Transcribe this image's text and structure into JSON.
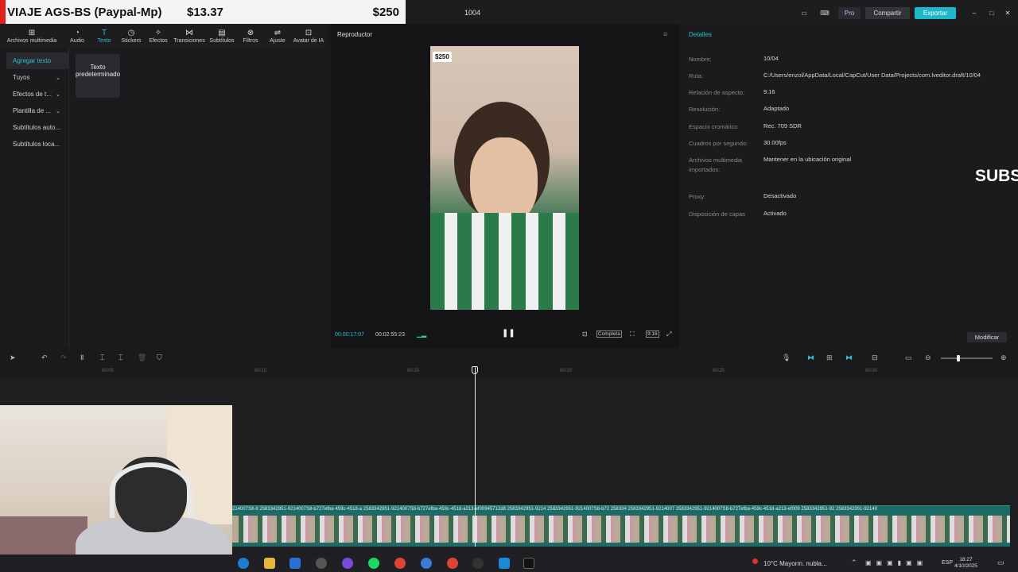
{
  "donation": {
    "name": "VIAJE AGS-BS (Paypal-Mp)",
    "amount_1": "$13.37",
    "amount_2": "$250"
  },
  "titlebar": {
    "project": "1004",
    "pro_label": "Pro",
    "share_label": "Compartir",
    "export_label": "Exportar"
  },
  "toolbar": [
    {
      "label": "Archivos multimedia",
      "icon": "media-icon"
    },
    {
      "label": "Audio",
      "icon": "audio-icon"
    },
    {
      "label": "Texto",
      "icon": "text-icon",
      "active": true
    },
    {
      "label": "Stickers",
      "icon": "sticker-icon"
    },
    {
      "label": "Efectos",
      "icon": "effects-icon"
    },
    {
      "label": "Transiciones",
      "icon": "transition-icon"
    },
    {
      "label": "Subtítulos",
      "icon": "subtitle-icon"
    },
    {
      "label": "Filtros",
      "icon": "filter-icon"
    },
    {
      "label": "Ajuste",
      "icon": "adjust-icon"
    },
    {
      "label": "Avatar de IA",
      "icon": "avatar-icon"
    }
  ],
  "sidebar": [
    {
      "label": "Agregar texto",
      "active": true
    },
    {
      "label": "Tuyos",
      "chevron": true
    },
    {
      "label": "Efectos de t...",
      "chevron": true
    },
    {
      "label": "Plantilla de ...",
      "chevron": true
    },
    {
      "label": "Subtítulos auto..."
    },
    {
      "label": "Subtítulos loca..."
    }
  ],
  "text_card": "Texto predeterminado",
  "player": {
    "title": "Reproductor",
    "badge": "$250",
    "time_current": "00:00:17:07",
    "time_total": "00:02:55:23",
    "ratio_label": "Completa",
    "aspect_label": "9:16"
  },
  "details": {
    "title": "Detalles",
    "rows": [
      {
        "key": "Nombre:",
        "value": "10/04"
      },
      {
        "key": "Ruta:",
        "value": "C:/Users/enzol/AppData/Local/CapCut/User Data/Projects/com.lveditor.draft/10/04"
      },
      {
        "key": "Relación de aspecto:",
        "value": "9:16"
      },
      {
        "key": "Resolución:",
        "value": "Adaptado"
      },
      {
        "key": "Espacio cromático",
        "value": "Rec. 709 SDR"
      },
      {
        "key": "Cuadros por segundo:",
        "value": "30.00fps"
      },
      {
        "key": "Archivos multimedia importados:",
        "value": "Mantener en la ubicación original"
      },
      {
        "key": "Proxy:",
        "value": "Desactivado"
      },
      {
        "key": "Disposición de capas",
        "value": "Activado"
      }
    ],
    "modify_label": "Modificar"
  },
  "overlay_subs": "SUBS",
  "timeline": {
    "ruler": [
      "00:05",
      "00:10",
      "00:15",
      "00:20",
      "00:25",
      "00:30"
    ],
    "clip_label": "214007S8-8  2583342951-9214007S8-b727efba-459c-4518-a  2583342951-9214007S8-b727efba-459c-4518-a213-ef00945712d8  2583342951-9214  2583342951-9214007S8-b72  258334  2583342951-9214007  2583342951-9214007S8-b727efba-459c-4518-a213-ef009  2583342951-92  2583342951-92140"
  },
  "taskbar": {
    "weather": "10°C  Mayorm. nubla...",
    "lang": "ESP",
    "time": "18:27",
    "date": "4/10/2025"
  }
}
